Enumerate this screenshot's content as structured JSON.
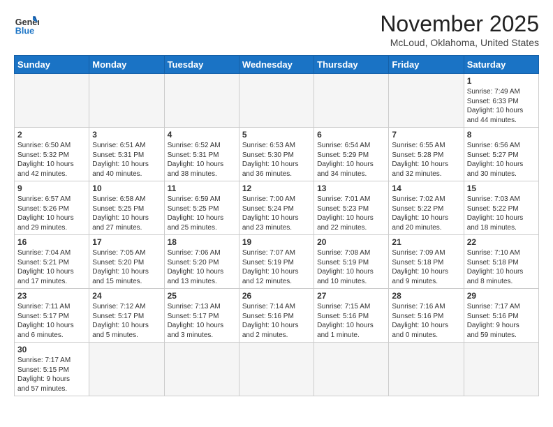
{
  "header": {
    "logo_general": "General",
    "logo_blue": "Blue",
    "month_title": "November 2025",
    "location": "McLoud, Oklahoma, United States"
  },
  "weekdays": [
    "Sunday",
    "Monday",
    "Tuesday",
    "Wednesday",
    "Thursday",
    "Friday",
    "Saturday"
  ],
  "weeks": [
    [
      {
        "day": "",
        "info": ""
      },
      {
        "day": "",
        "info": ""
      },
      {
        "day": "",
        "info": ""
      },
      {
        "day": "",
        "info": ""
      },
      {
        "day": "",
        "info": ""
      },
      {
        "day": "",
        "info": ""
      },
      {
        "day": "1",
        "info": "Sunrise: 7:49 AM\nSunset: 6:33 PM\nDaylight: 10 hours\nand 44 minutes."
      }
    ],
    [
      {
        "day": "2",
        "info": "Sunrise: 6:50 AM\nSunset: 5:32 PM\nDaylight: 10 hours\nand 42 minutes."
      },
      {
        "day": "3",
        "info": "Sunrise: 6:51 AM\nSunset: 5:31 PM\nDaylight: 10 hours\nand 40 minutes."
      },
      {
        "day": "4",
        "info": "Sunrise: 6:52 AM\nSunset: 5:31 PM\nDaylight: 10 hours\nand 38 minutes."
      },
      {
        "day": "5",
        "info": "Sunrise: 6:53 AM\nSunset: 5:30 PM\nDaylight: 10 hours\nand 36 minutes."
      },
      {
        "day": "6",
        "info": "Sunrise: 6:54 AM\nSunset: 5:29 PM\nDaylight: 10 hours\nand 34 minutes."
      },
      {
        "day": "7",
        "info": "Sunrise: 6:55 AM\nSunset: 5:28 PM\nDaylight: 10 hours\nand 32 minutes."
      },
      {
        "day": "8",
        "info": "Sunrise: 6:56 AM\nSunset: 5:27 PM\nDaylight: 10 hours\nand 30 minutes."
      }
    ],
    [
      {
        "day": "9",
        "info": "Sunrise: 6:57 AM\nSunset: 5:26 PM\nDaylight: 10 hours\nand 29 minutes."
      },
      {
        "day": "10",
        "info": "Sunrise: 6:58 AM\nSunset: 5:25 PM\nDaylight: 10 hours\nand 27 minutes."
      },
      {
        "day": "11",
        "info": "Sunrise: 6:59 AM\nSunset: 5:25 PM\nDaylight: 10 hours\nand 25 minutes."
      },
      {
        "day": "12",
        "info": "Sunrise: 7:00 AM\nSunset: 5:24 PM\nDaylight: 10 hours\nand 23 minutes."
      },
      {
        "day": "13",
        "info": "Sunrise: 7:01 AM\nSunset: 5:23 PM\nDaylight: 10 hours\nand 22 minutes."
      },
      {
        "day": "14",
        "info": "Sunrise: 7:02 AM\nSunset: 5:22 PM\nDaylight: 10 hours\nand 20 minutes."
      },
      {
        "day": "15",
        "info": "Sunrise: 7:03 AM\nSunset: 5:22 PM\nDaylight: 10 hours\nand 18 minutes."
      }
    ],
    [
      {
        "day": "16",
        "info": "Sunrise: 7:04 AM\nSunset: 5:21 PM\nDaylight: 10 hours\nand 17 minutes."
      },
      {
        "day": "17",
        "info": "Sunrise: 7:05 AM\nSunset: 5:20 PM\nDaylight: 10 hours\nand 15 minutes."
      },
      {
        "day": "18",
        "info": "Sunrise: 7:06 AM\nSunset: 5:20 PM\nDaylight: 10 hours\nand 13 minutes."
      },
      {
        "day": "19",
        "info": "Sunrise: 7:07 AM\nSunset: 5:19 PM\nDaylight: 10 hours\nand 12 minutes."
      },
      {
        "day": "20",
        "info": "Sunrise: 7:08 AM\nSunset: 5:19 PM\nDaylight: 10 hours\nand 10 minutes."
      },
      {
        "day": "21",
        "info": "Sunrise: 7:09 AM\nSunset: 5:18 PM\nDaylight: 10 hours\nand 9 minutes."
      },
      {
        "day": "22",
        "info": "Sunrise: 7:10 AM\nSunset: 5:18 PM\nDaylight: 10 hours\nand 8 minutes."
      }
    ],
    [
      {
        "day": "23",
        "info": "Sunrise: 7:11 AM\nSunset: 5:17 PM\nDaylight: 10 hours\nand 6 minutes."
      },
      {
        "day": "24",
        "info": "Sunrise: 7:12 AM\nSunset: 5:17 PM\nDaylight: 10 hours\nand 5 minutes."
      },
      {
        "day": "25",
        "info": "Sunrise: 7:13 AM\nSunset: 5:17 PM\nDaylight: 10 hours\nand 3 minutes."
      },
      {
        "day": "26",
        "info": "Sunrise: 7:14 AM\nSunset: 5:16 PM\nDaylight: 10 hours\nand 2 minutes."
      },
      {
        "day": "27",
        "info": "Sunrise: 7:15 AM\nSunset: 5:16 PM\nDaylight: 10 hours\nand 1 minute."
      },
      {
        "day": "28",
        "info": "Sunrise: 7:16 AM\nSunset: 5:16 PM\nDaylight: 10 hours\nand 0 minutes."
      },
      {
        "day": "29",
        "info": "Sunrise: 7:17 AM\nSunset: 5:16 PM\nDaylight: 9 hours\nand 59 minutes."
      }
    ],
    [
      {
        "day": "30",
        "info": "Sunrise: 7:17 AM\nSunset: 5:15 PM\nDaylight: 9 hours\nand 57 minutes."
      },
      {
        "day": "",
        "info": ""
      },
      {
        "day": "",
        "info": ""
      },
      {
        "day": "",
        "info": ""
      },
      {
        "day": "",
        "info": ""
      },
      {
        "day": "",
        "info": ""
      },
      {
        "day": "",
        "info": ""
      }
    ]
  ]
}
